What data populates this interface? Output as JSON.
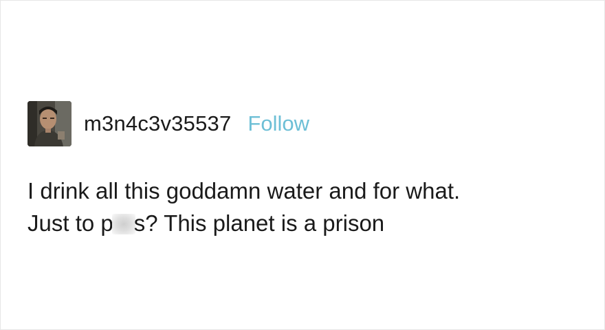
{
  "post": {
    "username": "m3n4c3v35537",
    "follow_label": "Follow",
    "text_line1": "I drink all this goddamn water and for what.",
    "text_line2_before": "Just to p",
    "text_line2_after": "s? This planet is a prison"
  },
  "colors": {
    "follow": "#6dbfd6",
    "text": "#1a1a1a",
    "background": "#ffffff"
  },
  "icons": {
    "avatar": "user-avatar-photo"
  }
}
